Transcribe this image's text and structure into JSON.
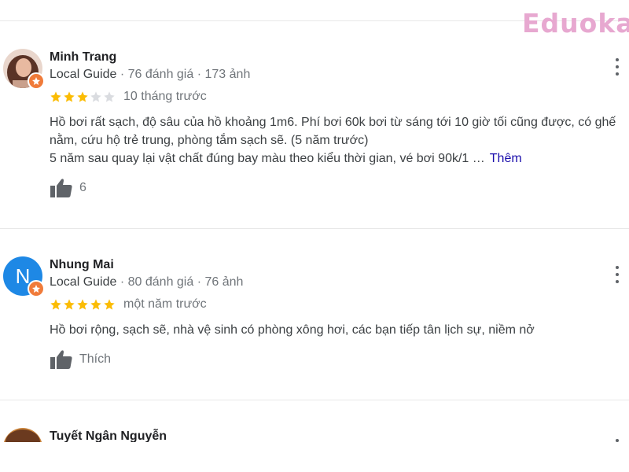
{
  "watermark": "Eduoka",
  "reviews": [
    {
      "author": "Minh Trang",
      "guide": "Local Guide",
      "reviews_count": "76 đánh giá",
      "photos_count": "173 ảnh",
      "rating": 3,
      "date": "10 tháng trước",
      "text_lines": [
        "Hồ bơi rất sạch, độ sâu của hồ khoảng 1m6. Phí bơi 60k bơi từ sáng tới 10 giờ tối cũng được, có ghế",
        "nằm, cứu hộ trẻ trung, phòng tắm sạch sẽ. (5 năm trước)",
        "5 năm sau quay lại vật chất đúng bay màu theo kiểu thời gian, vé bơi 90k/1 …"
      ],
      "more_label": "Thêm",
      "like_label": "6",
      "avatar_color": "#8a5a48"
    },
    {
      "author": "Nhung Mai",
      "guide": "Local Guide",
      "reviews_count": "80 đánh giá",
      "photos_count": "76 ảnh",
      "rating": 5,
      "date": "một năm trước",
      "text_lines": [
        "Hồ bơi rộng, sạch sẽ, nhà vệ sinh có phòng xông hơi, các bạn tiếp tân lịch sự, niềm nở"
      ],
      "like_label": "Thích",
      "avatar_letter": "N",
      "avatar_color": "#1e88e5"
    },
    {
      "author": "Tuyết Ngân Nguyễn",
      "avatar_color": "#6b3a1f"
    }
  ],
  "colors": {
    "star_filled": "#fbbc04",
    "star_empty": "#dadce0",
    "badge": "#f07b3a",
    "link": "#1a0dab"
  }
}
